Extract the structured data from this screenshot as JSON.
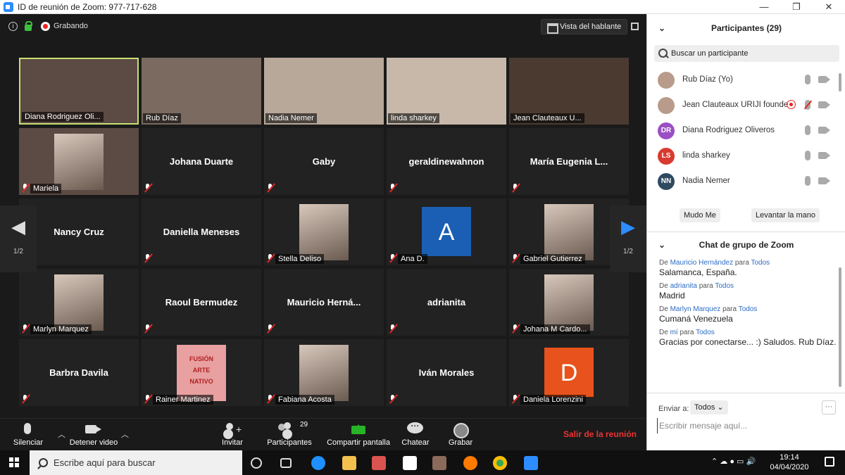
{
  "window": {
    "title": "ID de reunión de Zoom: 977-717-628",
    "minimize": "—",
    "maximize": "❐",
    "close": "✕"
  },
  "topbar": {
    "recording_label": "Grabando",
    "speaker_view": "Vista del hablante"
  },
  "gallery": {
    "page_indicator": "1/2",
    "tiles": [
      {
        "name": "Diana Rodriguez Oli...",
        "has_video": true,
        "show_name_center": false,
        "active_speaker": true,
        "muted": false
      },
      {
        "name": "Rub Díaz",
        "has_video": true,
        "show_name_center": false,
        "active_speaker": false,
        "muted": false
      },
      {
        "name": "Nadia Nemer",
        "has_video": true,
        "show_name_center": false,
        "active_speaker": false,
        "muted": false
      },
      {
        "name": "linda sharkey",
        "has_video": true,
        "show_name_center": false,
        "active_speaker": false,
        "muted": false
      },
      {
        "name": "Jean Clauteaux U...",
        "has_video": true,
        "show_name_center": false,
        "active_speaker": false,
        "muted": false
      },
      {
        "name": "Mariela",
        "has_video": true,
        "show_name_center": false,
        "active_speaker": false,
        "muted": true,
        "picture": "blurred-photo"
      },
      {
        "name": "Johana Duarte",
        "has_video": false,
        "show_name_center": true,
        "active_speaker": false,
        "muted": true
      },
      {
        "name": "Gaby",
        "has_video": false,
        "show_name_center": true,
        "active_speaker": false,
        "muted": true
      },
      {
        "name": "geraldinewahnon",
        "has_video": false,
        "show_name_center": true,
        "active_speaker": false,
        "muted": true
      },
      {
        "name": "María  Eugenia  L...",
        "has_video": false,
        "show_name_center": true,
        "active_speaker": false,
        "muted": true
      },
      {
        "name": "Nancy Cruz",
        "has_video": false,
        "show_name_center": true,
        "active_speaker": false,
        "muted": true
      },
      {
        "name": "Daniella Meneses",
        "has_video": false,
        "show_name_center": true,
        "active_speaker": false,
        "muted": true
      },
      {
        "name": "Stella Deliso",
        "has_video": false,
        "show_name_center": false,
        "active_speaker": false,
        "muted": true,
        "picture": "profile-photo"
      },
      {
        "name": "Ana D.",
        "has_video": false,
        "show_name_center": false,
        "active_speaker": false,
        "muted": true,
        "picture": "letter-avatar",
        "letter": "A",
        "letter_color": "#1a5fb4"
      },
      {
        "name": "Gabriel Gutierrez",
        "has_video": false,
        "show_name_center": false,
        "active_speaker": false,
        "muted": true,
        "picture": "profile-photo"
      },
      {
        "name": "Marlyn Marquez",
        "has_video": false,
        "show_name_center": false,
        "active_speaker": false,
        "muted": true,
        "picture": "profile-photo"
      },
      {
        "name": "Raoul Bermudez",
        "has_video": false,
        "show_name_center": true,
        "active_speaker": false,
        "muted": true
      },
      {
        "name": "Mauricio  Herná...",
        "has_video": false,
        "show_name_center": true,
        "active_speaker": false,
        "muted": true
      },
      {
        "name": "adrianita",
        "has_video": false,
        "show_name_center": true,
        "active_speaker": false,
        "muted": true
      },
      {
        "name": "Johana M Cardo...",
        "has_video": false,
        "show_name_center": false,
        "active_speaker": false,
        "muted": true,
        "picture": "profile-photo"
      },
      {
        "name": "Barbra Davila",
        "has_video": false,
        "show_name_center": true,
        "active_speaker": false,
        "muted": true
      },
      {
        "name": "Rainer Martinez",
        "has_video": false,
        "show_name_center": false,
        "active_speaker": false,
        "muted": true,
        "picture": "logo-image",
        "logo_text": [
          "FUSIÓN",
          "ARTE",
          "NATIVO"
        ],
        "logo_color": "#e8a0a0"
      },
      {
        "name": "Fabiana Acosta",
        "has_video": false,
        "show_name_center": false,
        "active_speaker": false,
        "muted": true,
        "picture": "profile-photo"
      },
      {
        "name": "Iván Morales",
        "has_video": false,
        "show_name_center": true,
        "active_speaker": false,
        "muted": true
      },
      {
        "name": "Daniela Lorenzini",
        "has_video": false,
        "show_name_center": false,
        "active_speaker": false,
        "muted": true,
        "picture": "letter-avatar",
        "letter": "D",
        "letter_color": "#e8521c"
      }
    ]
  },
  "controls": {
    "mute": "Silenciar",
    "stop_video": "Detener video",
    "invite": "Invitar",
    "participants": "Participantes",
    "participants_count": "29",
    "share": "Compartir pantalla",
    "chat": "Chatear",
    "record": "Grabar",
    "leave": "Salir de la reunión"
  },
  "participants_panel": {
    "title": "Participantes (29)",
    "search_placeholder": "Buscar un participante",
    "list": [
      {
        "name": "Rub Díaz (Yo)",
        "avatar": "photo",
        "recording": false,
        "mic_muted": false
      },
      {
        "name": "Jean Clauteaux URIJI founde",
        "avatar": "photo",
        "recording": true,
        "mic_muted": true
      },
      {
        "name": "Diana Rodriguez Oliveros",
        "avatar": "initials",
        "initials": "DR",
        "color": "#9b4fc4",
        "recording": false,
        "mic_muted": false
      },
      {
        "name": "linda sharkey",
        "avatar": "initials",
        "initials": "LS",
        "color": "#d93a2f",
        "recording": false,
        "mic_muted": false
      },
      {
        "name": "Nadia Nemer",
        "avatar": "initials",
        "initials": "NN",
        "color": "#2f4a60",
        "recording": false,
        "mic_muted": false
      }
    ],
    "mute_me": "Mudo Me",
    "raise_hand": "Levantar la mano"
  },
  "chat_panel": {
    "title": "Chat de grupo de Zoom",
    "messages": [
      {
        "prefix": "De",
        "from": "Mauricio Hernández",
        "to_word": "para",
        "to": "Todos",
        "text": "Salamanca, España."
      },
      {
        "prefix": "De",
        "from": "adrianita",
        "to_word": "para",
        "to": "Todos",
        "text": "Madrid"
      },
      {
        "prefix": "De",
        "from": "Marlyn Marquez",
        "to_word": "para",
        "to": "Todos",
        "text": "Cumaná Venezuela"
      },
      {
        "prefix": "De",
        "from": "mí",
        "to_word": "para",
        "to": "Todos",
        "text": "Gracias por conectarse... :) Saludos. Rub Díaz."
      }
    ],
    "send_to_label": "Enviar a:",
    "send_to_value": "Todos",
    "more": "···",
    "input_placeholder": "Escribir mensaje aquí..."
  },
  "taskbar": {
    "search_placeholder": "Escribe aquí para buscar",
    "time": "19:14",
    "date": "04/04/2020",
    "tray_symbols": "⌃  ☁  ●  ▭  🔊"
  },
  "colors": {
    "meeting_bg": "#1a1a1a",
    "tile_bg": "#222222",
    "active_speaker_border": "#c6e070",
    "zoom_blue": "#2d8cff",
    "leave_red": "#e33333",
    "share_green": "#28b428"
  }
}
